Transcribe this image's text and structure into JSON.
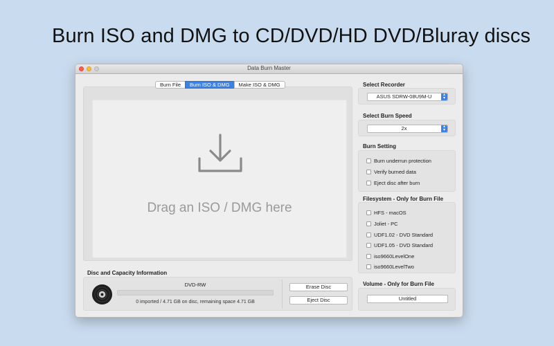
{
  "headline": "Burn ISO and DMG to CD/DVD/HD DVD/Bluray discs",
  "window": {
    "title": "Data Burn Master"
  },
  "tabs": [
    {
      "label": "Burn File",
      "active": false
    },
    {
      "label": "Burn ISO & DMG",
      "active": true
    },
    {
      "label": "Make ISO & DMG",
      "active": false
    }
  ],
  "drop_zone": {
    "text": "Drag an ISO / DMG here",
    "icon": "download-icon"
  },
  "disc_info": {
    "label": "Disc and Capacity Information",
    "disc_type": "DVD-RW",
    "capacity_text": "0 imported / 4.71 GB on disc, remaining space 4.71 GB",
    "progress": 0,
    "erase_label": "Erase Disc",
    "eject_label": "Eject Disc"
  },
  "recorder": {
    "label": "Select Recorder",
    "value": "ASUS SDRW-08U9M-U"
  },
  "burn_speed": {
    "label": "Select Burn Speed",
    "value": "2x"
  },
  "burn_setting": {
    "label": "Burn Setting",
    "options": [
      {
        "label": "Burn underrun protection",
        "checked": false
      },
      {
        "label": "Verify burned data",
        "checked": false
      },
      {
        "label": "Eject disc after burn",
        "checked": false
      }
    ]
  },
  "filesystem": {
    "label": "Filesystem - Only for Burn File",
    "options": [
      {
        "label": "HFS - macOS",
        "checked": false
      },
      {
        "label": "Joliet - PC",
        "checked": false
      },
      {
        "label": "UDF1.02 - DVD Standard",
        "checked": false
      },
      {
        "label": "UDF1.05 - DVD Standard",
        "checked": false
      },
      {
        "label": "iso9660LevelOne",
        "checked": false
      },
      {
        "label": "iso9660LevelTwo",
        "checked": false
      }
    ]
  },
  "volume": {
    "label": "Volume - Only for Burn File",
    "value": "Untitled"
  },
  "colors": {
    "accent": "#3b82e6",
    "background": "#c9dcef",
    "window": "#ececec"
  }
}
